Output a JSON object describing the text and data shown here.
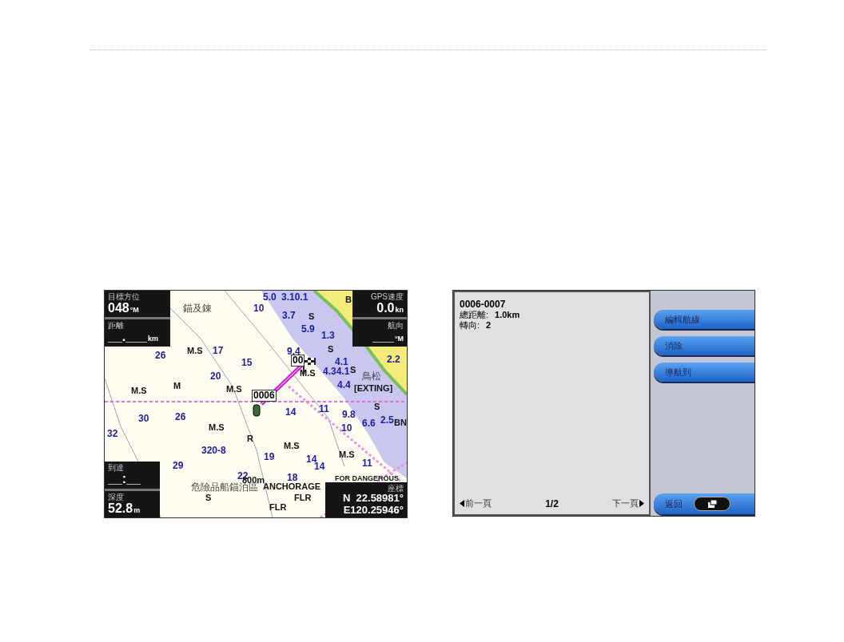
{
  "map_screen": {
    "top_left_fields": [
      {
        "label": "目標方位",
        "value": "048",
        "unit": "°M"
      },
      {
        "label": "距離",
        "value": "__.___",
        "unit": "km"
      }
    ],
    "top_right_fields": [
      {
        "label": "GPS速度",
        "value": "0.0",
        "unit": "kn"
      },
      {
        "label": "航向",
        "value": "___",
        "unit": "°M"
      }
    ],
    "bottom_left_fields": [
      {
        "label": "到達",
        "value": "__:__"
      },
      {
        "label": "深度",
        "value": "52.8",
        "unit": "m"
      }
    ],
    "coordinates": {
      "label": "座標",
      "lines": [
        "N  22.58981°",
        "E120.25946°"
      ]
    },
    "waypoints": [
      "0006",
      "00"
    ],
    "chart_labels": [
      {
        "text": "5.0",
        "kind": "depth"
      },
      {
        "text": "3.10.1",
        "kind": "depth"
      },
      {
        "text": "10",
        "kind": "depth"
      },
      {
        "text": "3.7",
        "kind": "depth"
      },
      {
        "text": "5.9",
        "kind": "depth"
      },
      {
        "text": "1.3",
        "kind": "depth"
      },
      {
        "text": "9.4",
        "kind": "depth"
      },
      {
        "text": "4.1",
        "kind": "depth"
      },
      {
        "text": "4.34.1",
        "kind": "depth"
      },
      {
        "text": "4.4",
        "kind": "depth"
      },
      {
        "text": "2.2",
        "kind": "depth"
      },
      {
        "text": "26",
        "kind": "depth"
      },
      {
        "text": "17",
        "kind": "depth"
      },
      {
        "text": "15",
        "kind": "depth"
      },
      {
        "text": "20",
        "kind": "depth"
      },
      {
        "text": "30",
        "kind": "depth"
      },
      {
        "text": "26",
        "kind": "depth"
      },
      {
        "text": "32",
        "kind": "depth"
      },
      {
        "text": "14",
        "kind": "depth"
      },
      {
        "text": "11",
        "kind": "depth"
      },
      {
        "text": "9.8",
        "kind": "depth"
      },
      {
        "text": "10",
        "kind": "depth"
      },
      {
        "text": "6.6",
        "kind": "depth"
      },
      {
        "text": "2.5",
        "kind": "depth"
      },
      {
        "text": "320-8",
        "kind": "depth"
      },
      {
        "text": "29",
        "kind": "depth"
      },
      {
        "text": "19",
        "kind": "depth"
      },
      {
        "text": "14",
        "kind": "depth"
      },
      {
        "text": "18",
        "kind": "depth"
      },
      {
        "text": "14",
        "kind": "depth"
      },
      {
        "text": "11",
        "kind": "depth"
      },
      {
        "text": "22",
        "kind": "depth"
      },
      {
        "text": "M.S",
        "kind": "seabed"
      },
      {
        "text": "M.S",
        "kind": "seabed"
      },
      {
        "text": "M",
        "kind": "seabed"
      },
      {
        "text": "M.S",
        "kind": "seabed"
      },
      {
        "text": "M.S",
        "kind": "seabed"
      },
      {
        "text": "M.S",
        "kind": "seabed"
      },
      {
        "text": "M.S",
        "kind": "seabed"
      },
      {
        "text": "M.S",
        "kind": "seabed"
      },
      {
        "text": "R",
        "kind": "seabed"
      },
      {
        "text": "S",
        "kind": "seabed"
      },
      {
        "text": "S",
        "kind": "seabed"
      },
      {
        "text": "S",
        "kind": "seabed"
      },
      {
        "text": "S",
        "kind": "seabed"
      },
      {
        "text": "S",
        "kind": "seabed"
      },
      {
        "text": "B",
        "kind": "seabed"
      },
      {
        "text": "BN",
        "kind": "seabed"
      },
      {
        "text": "[EXTING]",
        "kind": "seabed"
      },
      {
        "text": "ANCHORAGE",
        "kind": "seabed"
      },
      {
        "text": "FOR DANGEROUS",
        "kind": "seabed"
      },
      {
        "text": "FLR",
        "kind": "seabed"
      },
      {
        "text": "FLR",
        "kind": "seabed"
      },
      {
        "text": "800m",
        "kind": "seabed"
      },
      {
        "text": "錨及錬",
        "kind": "name"
      },
      {
        "text": "危險品船錨泊區",
        "kind": "name"
      },
      {
        "text": "鳥松",
        "kind": "name"
      }
    ]
  },
  "route_screen": {
    "title": "0006-0007",
    "details": [
      {
        "label": "總距離:",
        "value": "1.0km"
      },
      {
        "label": "轉向:",
        "value": "2"
      }
    ],
    "prev": "前一頁",
    "page": "1/2",
    "next": "下一頁",
    "buttons": [
      "編輯航線",
      "消除",
      "導航到"
    ],
    "back": "返回"
  }
}
